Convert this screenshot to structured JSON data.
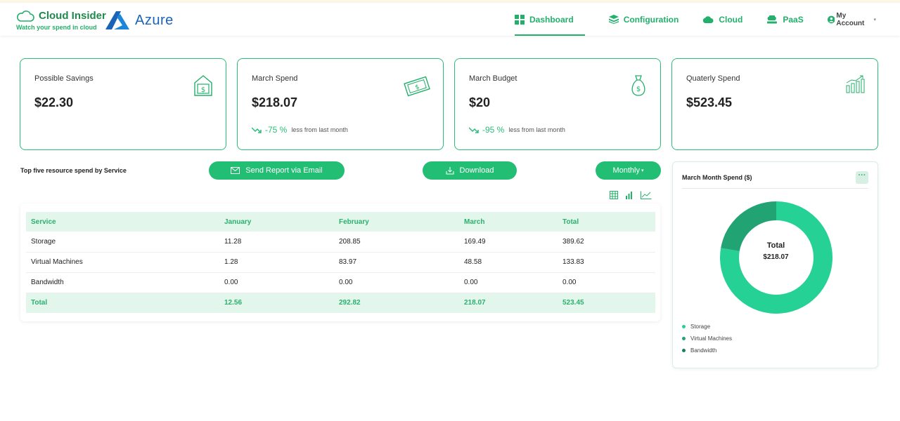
{
  "brand": {
    "name": "Cloud Insider",
    "tagline": "Watch your spend in cloud",
    "provider": "Azure"
  },
  "nav": {
    "items": [
      {
        "label": "Dashboard",
        "icon": "grid-icon"
      },
      {
        "label": "Configuration",
        "icon": "layers-icon"
      },
      {
        "label": "Cloud",
        "icon": "cloud-icon"
      },
      {
        "label": "PaaS",
        "icon": "paas-icon"
      }
    ],
    "account": "My Account"
  },
  "cards": [
    {
      "label": "Possible Savings",
      "value": "$22.30",
      "icon": "savings-house-icon"
    },
    {
      "label": "March Spend",
      "value": "$218.07",
      "icon": "money-bill-icon",
      "trend": {
        "pct": "-75 %",
        "note": "less from last month"
      }
    },
    {
      "label": "March Budget",
      "value": "$20",
      "icon": "money-bag-icon",
      "trend": {
        "pct": "-95 %",
        "note": "less from last month"
      }
    },
    {
      "label": "Quaterly Spend",
      "value": "$523.45",
      "icon": "growth-chart-icon"
    }
  ],
  "section": {
    "title": "Top five resource spend by Service",
    "send_report": "Send Report via Email",
    "download": "Download",
    "period": "Monthly"
  },
  "table": {
    "headers": [
      "Service",
      "January",
      "February",
      "March",
      "Total"
    ],
    "rows": [
      [
        "Storage",
        "11.28",
        "208.85",
        "169.49",
        "389.62"
      ],
      [
        "Virtual Machines",
        "1.28",
        "83.97",
        "48.58",
        "133.83"
      ],
      [
        "Bandwidth",
        "0.00",
        "0.00",
        "0.00",
        "0.00"
      ]
    ],
    "total": [
      "Total",
      "12.56",
      "292.82",
      "218.07",
      "523.45"
    ]
  },
  "donut": {
    "title": "March Month Spend ($)",
    "menu": "···",
    "center_label": "Total",
    "center_value": "$218.07",
    "legend": [
      {
        "label": "Storage",
        "color": "#26d196"
      },
      {
        "label": "Virtual Machines",
        "color": "#22a374"
      },
      {
        "label": "Bandwidth",
        "color": "#1f7d57"
      }
    ]
  },
  "chart_data": {
    "type": "pie",
    "title": "March Month Spend ($)",
    "categories": [
      "Storage",
      "Virtual Machines",
      "Bandwidth"
    ],
    "values": [
      169.49,
      48.58,
      0.0
    ],
    "colors": [
      "#26d196",
      "#22a374",
      "#1f7d57"
    ]
  },
  "colors": {
    "accent": "#22be74",
    "accent_light": "#e3f6ec",
    "azure_blue": "#1a64b8"
  }
}
